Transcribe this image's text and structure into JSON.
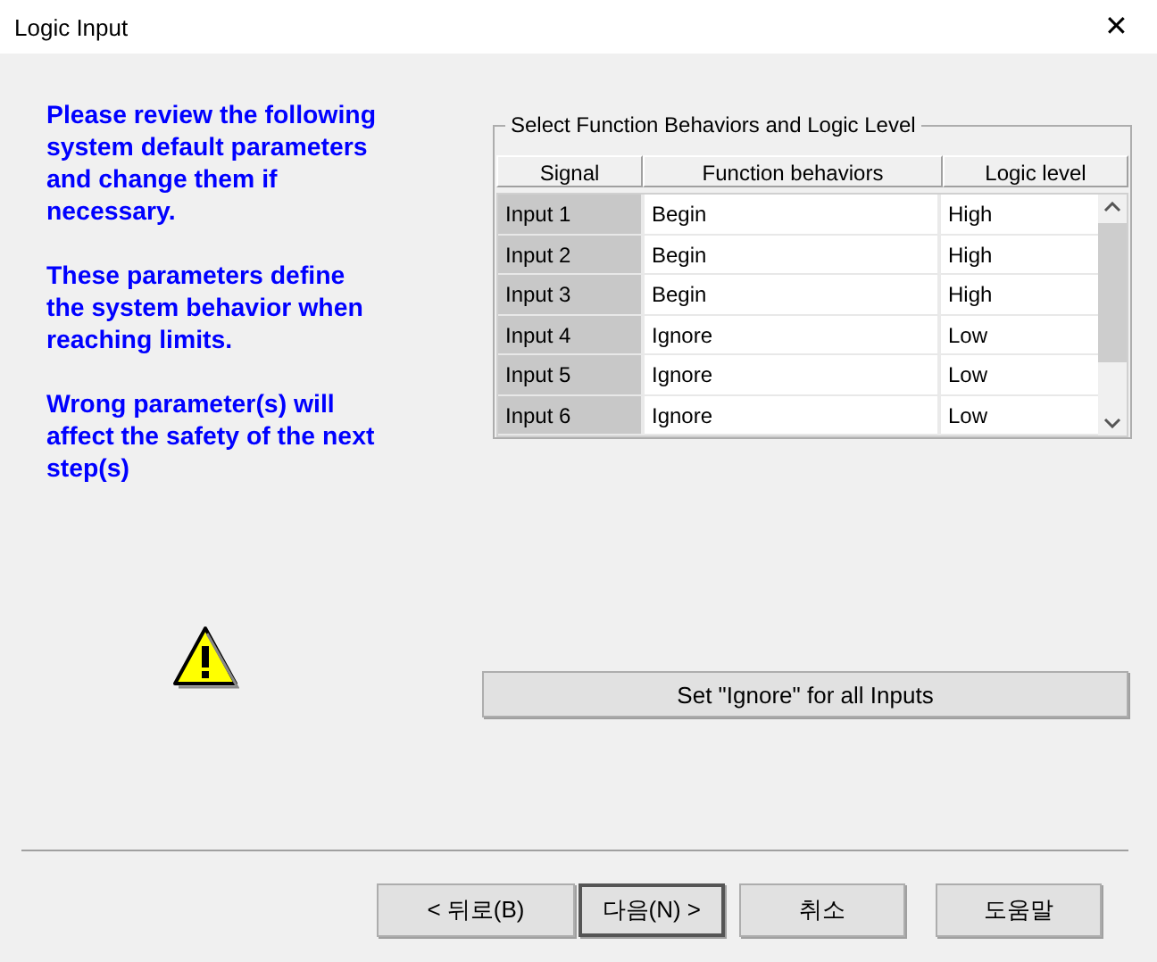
{
  "window": {
    "title": "Logic Input",
    "close": "✕"
  },
  "instructions": [
    "Please review the following system default parameters and change them if necessary.",
    "These parameters define the system behavior when reaching limits.",
    "Wrong parameter(s) will affect the safety of the next step(s)"
  ],
  "group": {
    "title": "Select Function Behaviors and Logic Level"
  },
  "table": {
    "columns": [
      "Signal",
      "Function behaviors",
      "Logic level"
    ],
    "rows": [
      {
        "signal": "Input 1",
        "behavior": "Begin",
        "level": "High"
      },
      {
        "signal": "Input 2",
        "behavior": "Begin",
        "level": "High"
      },
      {
        "signal": "Input 3",
        "behavior": "Begin",
        "level": "High"
      },
      {
        "signal": "Input 4",
        "behavior": "Ignore",
        "level": "Low"
      },
      {
        "signal": "Input 5",
        "behavior": "Ignore",
        "level": "Low"
      },
      {
        "signal": "Input 6",
        "behavior": "Ignore",
        "level": "Low"
      }
    ]
  },
  "set_all_button": "Set \"Ignore\" for all Inputs",
  "buttons": [
    {
      "label": "< 뒤로(B)",
      "default": false
    },
    {
      "label": "다음(N) >",
      "default": true
    },
    {
      "label": "취소",
      "default": false
    },
    {
      "label": "도움말",
      "default": false
    }
  ]
}
